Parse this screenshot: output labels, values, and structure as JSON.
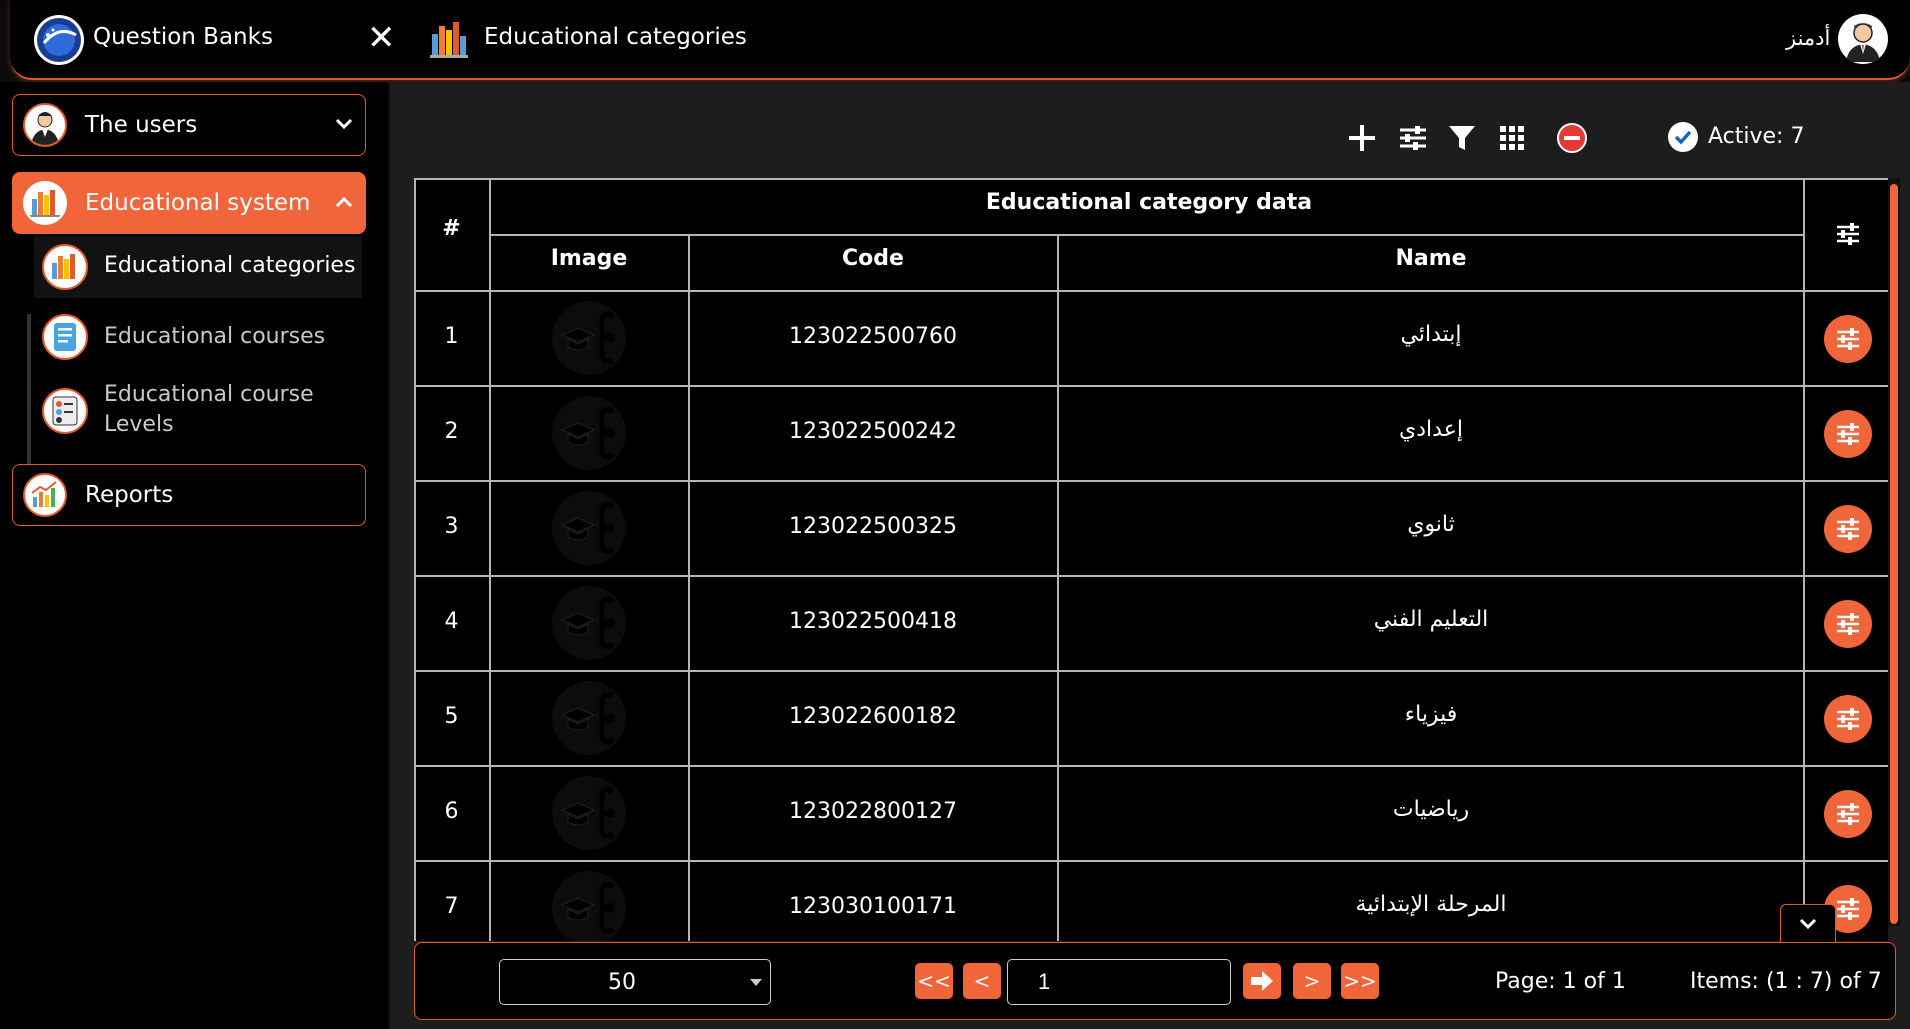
{
  "header": {
    "app_title": "Question Banks",
    "page_title": "Educational categories",
    "user_name": "أدمنز"
  },
  "sidebar": {
    "users": "The users",
    "educational_system": "Educational system",
    "sub_items": [
      "Educational categories",
      "Educational courses",
      "Educational course",
      "Levels"
    ],
    "reports": "Reports"
  },
  "toolbar": {
    "active_label": "Active: 7"
  },
  "table": {
    "group_header": "Educational category data",
    "columns": {
      "index": "#",
      "image": "Image",
      "code": "Code",
      "name": "Name"
    },
    "rows": [
      {
        "index": "1",
        "code": "123022500760",
        "name": "إبتدائي"
      },
      {
        "index": "2",
        "code": "123022500242",
        "name": "إعدادي"
      },
      {
        "index": "3",
        "code": "123022500325",
        "name": "ثانوي"
      },
      {
        "index": "4",
        "code": "123022500418",
        "name": "التعليم الفني"
      },
      {
        "index": "5",
        "code": "123022600182",
        "name": "فيزياء"
      },
      {
        "index": "6",
        "code": "123022800127",
        "name": "رياضيات"
      },
      {
        "index": "7",
        "code": "123030100171",
        "name": "المرحلة الإبتدائية"
      }
    ]
  },
  "footer": {
    "page_size": "50",
    "first": "<<",
    "prev": "<",
    "page_input": "1",
    "next": ">",
    "last": ">>",
    "page_info": "Page: 1 of 1",
    "items_info": "Items: (1 : 7) of 7"
  },
  "colors": {
    "accent": "#f0653a",
    "border": "#e25a2c",
    "background": "#1d1d1d"
  }
}
